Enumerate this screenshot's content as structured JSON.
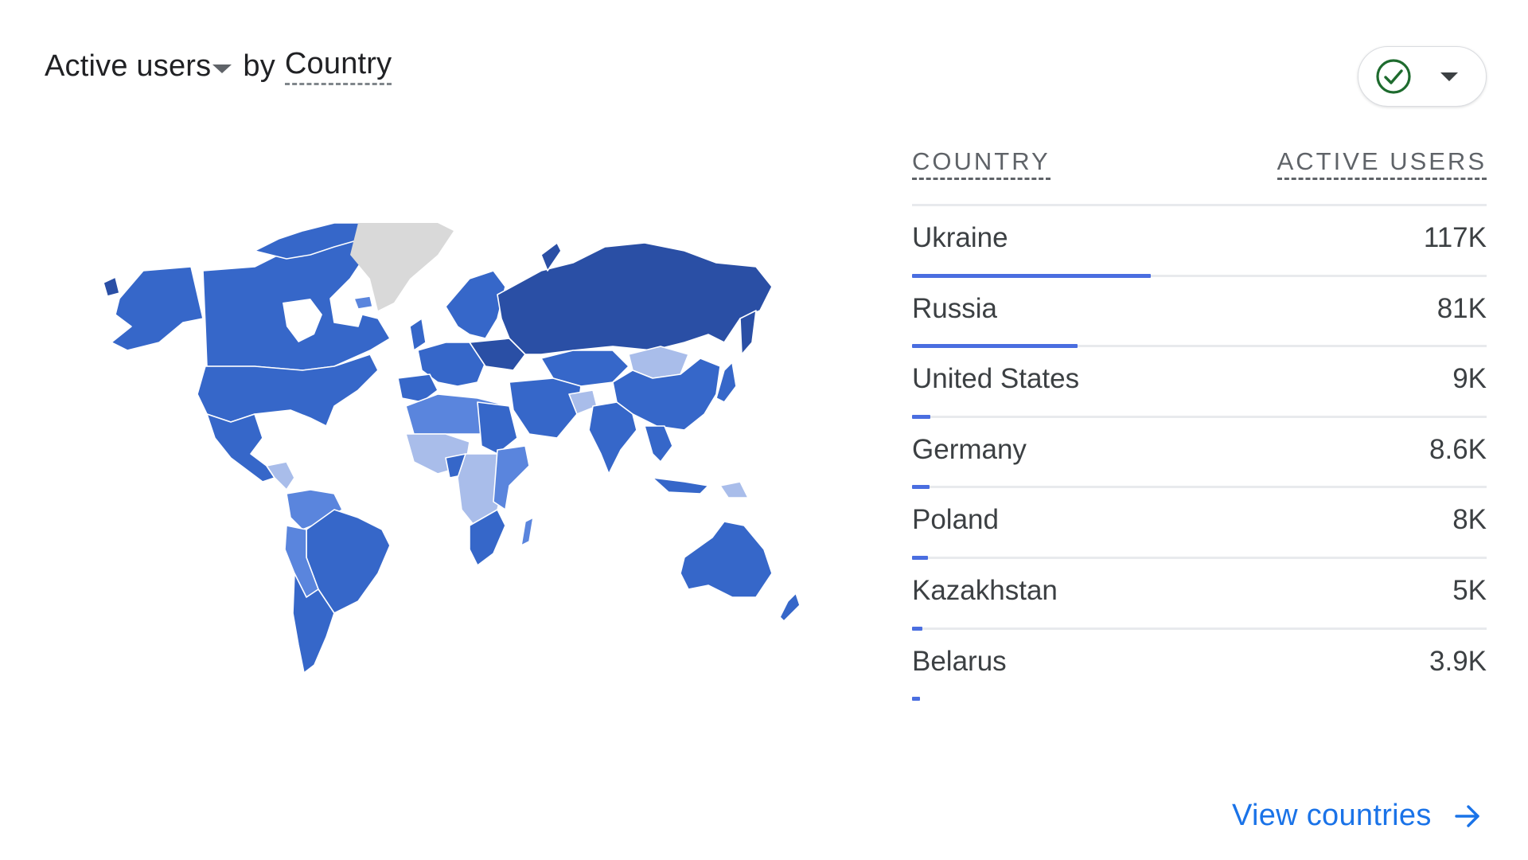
{
  "header": {
    "metric_label": "Active users",
    "connector": "by",
    "dimension_label": "Country"
  },
  "toolbar": {
    "status_icon": "check-circle-icon",
    "status_color": "#188038",
    "dropdown_icon": "caret-down-icon"
  },
  "table": {
    "columns": [
      "COUNTRY",
      "ACTIVE USERS"
    ],
    "bar_color": "#4a6ee0",
    "rows": [
      {
        "country": "Ukraine",
        "value": "117K",
        "bar_fraction": 0.416
      },
      {
        "country": "Russia",
        "value": "81K",
        "bar_fraction": 0.288
      },
      {
        "country": "United States",
        "value": "9K",
        "bar_fraction": 0.032
      },
      {
        "country": "Germany",
        "value": "8.6K",
        "bar_fraction": 0.03
      },
      {
        "country": "Poland",
        "value": "8K",
        "bar_fraction": 0.028
      },
      {
        "country": "Kazakhstan",
        "value": "5K",
        "bar_fraction": 0.018
      },
      {
        "country": "Belarus",
        "value": "3.9K",
        "bar_fraction": 0.014
      }
    ]
  },
  "map": {
    "type": "choropleth",
    "palette": {
      "highest": "#2a4fa5",
      "high": "#3667c9",
      "mid": "#5a85dd",
      "low": "#a9bdea",
      "no_data": "#d9d9d9"
    },
    "regions": [
      {
        "name": "Russia",
        "level": "highest"
      },
      {
        "name": "North America",
        "level": "high"
      },
      {
        "name": "South America",
        "level": "high"
      },
      {
        "name": "Europe",
        "level": "high"
      },
      {
        "name": "China",
        "level": "high"
      },
      {
        "name": "India",
        "level": "high"
      },
      {
        "name": "Kazakhstan",
        "level": "high"
      },
      {
        "name": "Middle East",
        "level": "high"
      },
      {
        "name": "Southeast Asia",
        "level": "high"
      },
      {
        "name": "Australia",
        "level": "high"
      },
      {
        "name": "Mongolia",
        "level": "low"
      },
      {
        "name": "North Africa",
        "level": "mid"
      },
      {
        "name": "West Africa",
        "level": "low"
      },
      {
        "name": "Central Africa",
        "level": "low"
      },
      {
        "name": "East Africa",
        "level": "mid"
      },
      {
        "name": "Southern Africa",
        "level": "high"
      },
      {
        "name": "Greenland",
        "level": "no_data"
      }
    ]
  },
  "footer": {
    "link_label": "View countries",
    "link_icon": "arrow-right-icon"
  }
}
